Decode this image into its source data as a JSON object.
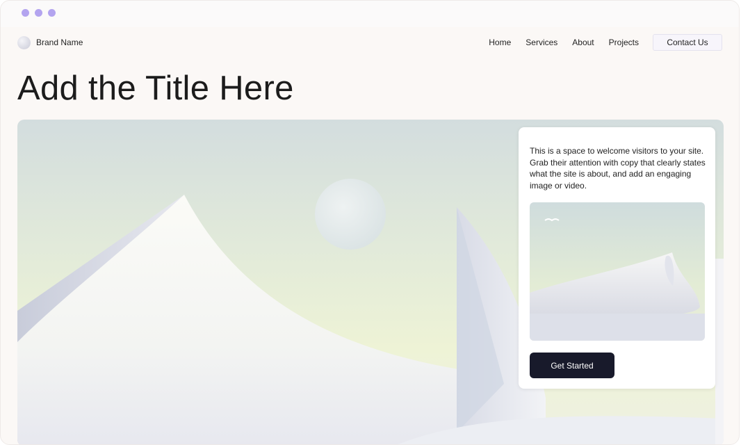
{
  "brand": {
    "name": "Brand Name"
  },
  "nav": {
    "items": [
      {
        "label": "Home"
      },
      {
        "label": "Services"
      },
      {
        "label": "About"
      },
      {
        "label": "Projects"
      }
    ],
    "contact_label": "Contact Us"
  },
  "hero": {
    "title": "Add the Title Here",
    "card_text": "This is a space to welcome visitors to your site. Grab their attention with copy that clearly states what the site is about, and add an engaging image or video.",
    "cta_label": "Get Started"
  },
  "colors": {
    "window_dots": "#b3a4ef",
    "cta_background": "#181a2b",
    "page_background": "#fbf8f6"
  }
}
